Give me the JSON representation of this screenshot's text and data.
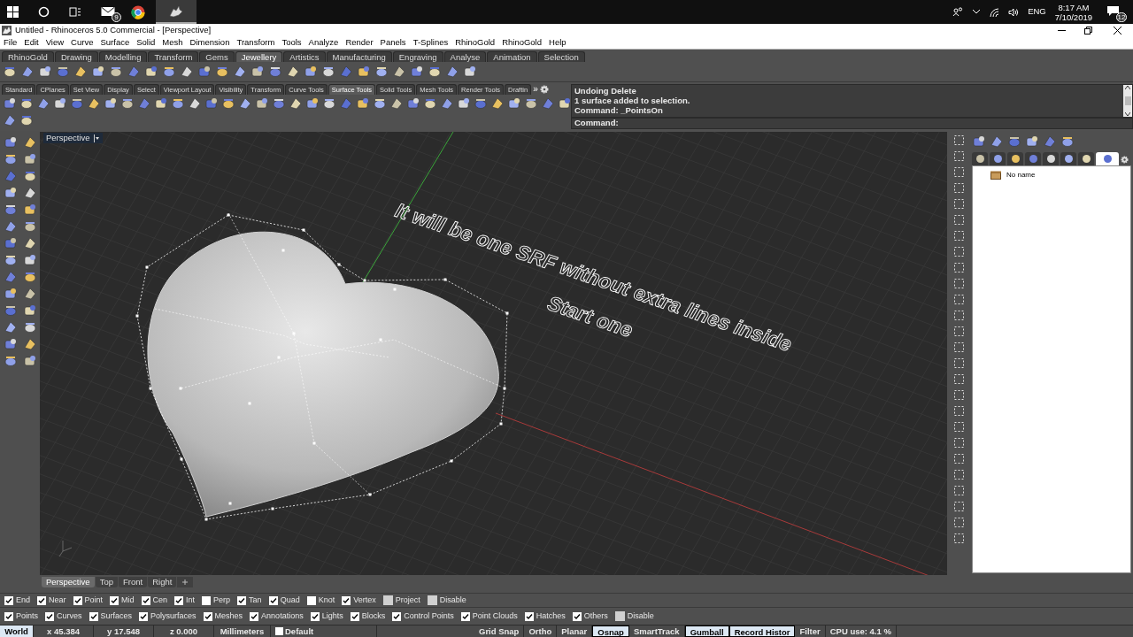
{
  "taskbar": {
    "mail_badge": "9",
    "tray": {
      "language": "ENG",
      "time": "8:17 AM",
      "date": "7/10/2019",
      "notifications": "12"
    }
  },
  "window": {
    "title": "Untitled - Rhinoceros 5.0 Commercial - [Perspective]"
  },
  "menu": [
    "File",
    "Edit",
    "View",
    "Curve",
    "Surface",
    "Solid",
    "Mesh",
    "Dimension",
    "Transform",
    "Tools",
    "Analyze",
    "Render",
    "Panels",
    "T-Splines",
    "RhinoGold",
    "RhinoGold",
    "Help"
  ],
  "toolbar_tabs": [
    {
      "label": "RhinoGold",
      "selected": false
    },
    {
      "label": "Drawing",
      "selected": false
    },
    {
      "label": "Modelling",
      "selected": false
    },
    {
      "label": "Transform",
      "selected": false
    },
    {
      "label": "Gems",
      "selected": false
    },
    {
      "label": "Jewellery",
      "selected": true
    },
    {
      "label": "Artistics",
      "selected": false
    },
    {
      "label": "Manufacturing",
      "selected": false
    },
    {
      "label": "Engraving",
      "selected": false
    },
    {
      "label": "Analyse",
      "selected": false
    },
    {
      "label": "Animation",
      "selected": false
    },
    {
      "label": "Selection",
      "selected": false
    }
  ],
  "toolbar_tabs_2": [
    {
      "label": "Standard",
      "selected": false
    },
    {
      "label": "CPlanes",
      "selected": false
    },
    {
      "label": "Set View",
      "selected": false
    },
    {
      "label": "Display",
      "selected": false
    },
    {
      "label": "Select",
      "selected": false
    },
    {
      "label": "Viewport Layout",
      "selected": false
    },
    {
      "label": "Visibility",
      "selected": false
    },
    {
      "label": "Transform",
      "selected": false
    },
    {
      "label": "Curve Tools",
      "selected": false
    },
    {
      "label": "Surface Tools",
      "selected": true
    },
    {
      "label": "Solid Tools",
      "selected": false
    },
    {
      "label": "Mesh Tools",
      "selected": false
    },
    {
      "label": "Render Tools",
      "selected": false
    },
    {
      "label": "Draftin",
      "selected": false
    }
  ],
  "toolbar_tabs_2_overflow": "»",
  "command": {
    "history": [
      "Undoing Delete",
      "1 surface added to selection.",
      "Command: _PointsOn"
    ],
    "prompt": "Command:"
  },
  "viewport": {
    "label": "Perspective",
    "annotations": [
      "It will be one SRF without extra lines inside",
      "Start one"
    ]
  },
  "viewport_tabs": [
    {
      "label": "Perspective",
      "selected": true
    },
    {
      "label": "Top",
      "selected": false
    },
    {
      "label": "Front",
      "selected": false
    },
    {
      "label": "Right",
      "selected": false
    }
  ],
  "layers_panel": {
    "tabs": [
      {
        "selected": false
      },
      {
        "selected": false
      },
      {
        "selected": false
      },
      {
        "selected": false
      },
      {
        "selected": false
      },
      {
        "selected": false
      },
      {
        "selected": false
      },
      {
        "selected": true
      }
    ],
    "items": [
      "No name"
    ]
  },
  "osnaps": [
    {
      "label": "End",
      "kind": "check",
      "checked": true
    },
    {
      "label": "Near",
      "kind": "check",
      "checked": true
    },
    {
      "label": "Point",
      "kind": "check",
      "checked": true
    },
    {
      "label": "Mid",
      "kind": "check",
      "checked": true
    },
    {
      "label": "Cen",
      "kind": "check",
      "checked": true
    },
    {
      "label": "Int",
      "kind": "check",
      "checked": true
    },
    {
      "label": "Perp",
      "kind": "check",
      "checked": false
    },
    {
      "label": "Tan",
      "kind": "check",
      "checked": true
    },
    {
      "label": "Quad",
      "kind": "check",
      "checked": true
    },
    {
      "label": "Knot",
      "kind": "check",
      "checked": false
    },
    {
      "label": "Vertex",
      "kind": "check",
      "checked": true
    },
    {
      "label": "Project",
      "kind": "toggle",
      "checked": false
    },
    {
      "label": "Disable",
      "kind": "toggle",
      "checked": false
    }
  ],
  "filters": [
    {
      "label": "Points",
      "kind": "check",
      "checked": true
    },
    {
      "label": "Curves",
      "kind": "check",
      "checked": true
    },
    {
      "label": "Surfaces",
      "kind": "check",
      "checked": true
    },
    {
      "label": "Polysurfaces",
      "kind": "check",
      "checked": true
    },
    {
      "label": "Meshes",
      "kind": "check",
      "checked": true
    },
    {
      "label": "Annotations",
      "kind": "check",
      "checked": true
    },
    {
      "label": "Lights",
      "kind": "check",
      "checked": true
    },
    {
      "label": "Blocks",
      "kind": "check",
      "checked": true
    },
    {
      "label": "Control Points",
      "kind": "check",
      "checked": true
    },
    {
      "label": "Point Clouds",
      "kind": "check",
      "checked": true
    },
    {
      "label": "Hatches",
      "kind": "check",
      "checked": true
    },
    {
      "label": "Others",
      "kind": "check",
      "checked": true
    },
    {
      "label": "Disable",
      "kind": "toggle",
      "checked": false
    }
  ],
  "status_bar": [
    {
      "label": "World",
      "kind": "cplane"
    },
    {
      "label": "x 45.384",
      "kind": "coord"
    },
    {
      "label": "y 17.548",
      "kind": "coord"
    },
    {
      "label": "z 0.000",
      "kind": "coord"
    },
    {
      "label": "Millimeters",
      "kind": "units"
    },
    {
      "label": "Default",
      "kind": "layer"
    },
    {
      "label": "Grid Snap",
      "kind": "pane",
      "on": false
    },
    {
      "label": "Ortho",
      "kind": "pane",
      "on": false
    },
    {
      "label": "Planar",
      "kind": "pane",
      "on": false
    },
    {
      "label": "Osnap",
      "kind": "pane",
      "on": true
    },
    {
      "label": "SmartTrack",
      "kind": "pane",
      "on": false
    },
    {
      "label": "Gumball",
      "kind": "pane",
      "on": true
    },
    {
      "label": "Record Histor",
      "kind": "pane",
      "on": true
    },
    {
      "label": "Filter",
      "kind": "pane",
      "on": false
    },
    {
      "label": "CPU use: 4.1 %",
      "kind": "info"
    }
  ]
}
